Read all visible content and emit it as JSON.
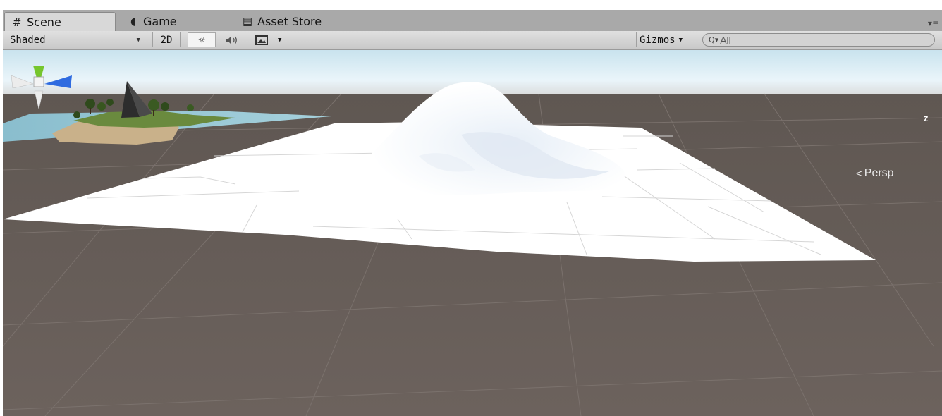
{
  "tabs": [
    {
      "label": "Scene",
      "icon": "hash-grid-icon",
      "active": true
    },
    {
      "label": "Game",
      "icon": "pacman-icon",
      "active": false
    },
    {
      "label": "Asset Store",
      "icon": "store-bag-icon",
      "active": false
    }
  ],
  "toolbar": {
    "draw_mode": "Shaded",
    "mode_2d": "2D",
    "lighting_icon": "sun-icon",
    "audio_icon": "speaker-icon",
    "effects_icon": "image-icon",
    "gizmos_label": "Gizmos",
    "search_placeholder": "All"
  },
  "scene": {
    "projection_label": "Persp",
    "axis_label": "z"
  },
  "colors": {
    "ground": "#6a605b",
    "terrain": "#ffffff",
    "sky": "#d6ecf4",
    "axis_y": "#76c62d",
    "axis_z": "#2f6be0"
  }
}
